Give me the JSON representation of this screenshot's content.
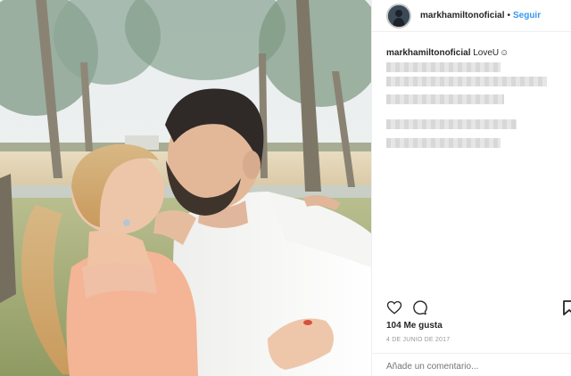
{
  "post": {
    "username": "markhamiltonoficial",
    "follow_label": "Seguir",
    "separator": "•",
    "caption_user": "markhamiltonoficial",
    "caption_text": "LoveU",
    "caption_emoji": "☺",
    "likes": "104 Me gusta",
    "date": "4 DE JUNIO DE 2017",
    "comment_placeholder": "Añade un comentario..."
  },
  "icons": {
    "like": "heart-icon",
    "comment": "comment-icon",
    "save": "bookmark-icon"
  },
  "colors": {
    "link": "#3897f0",
    "text": "#262626",
    "muted": "#999999"
  }
}
